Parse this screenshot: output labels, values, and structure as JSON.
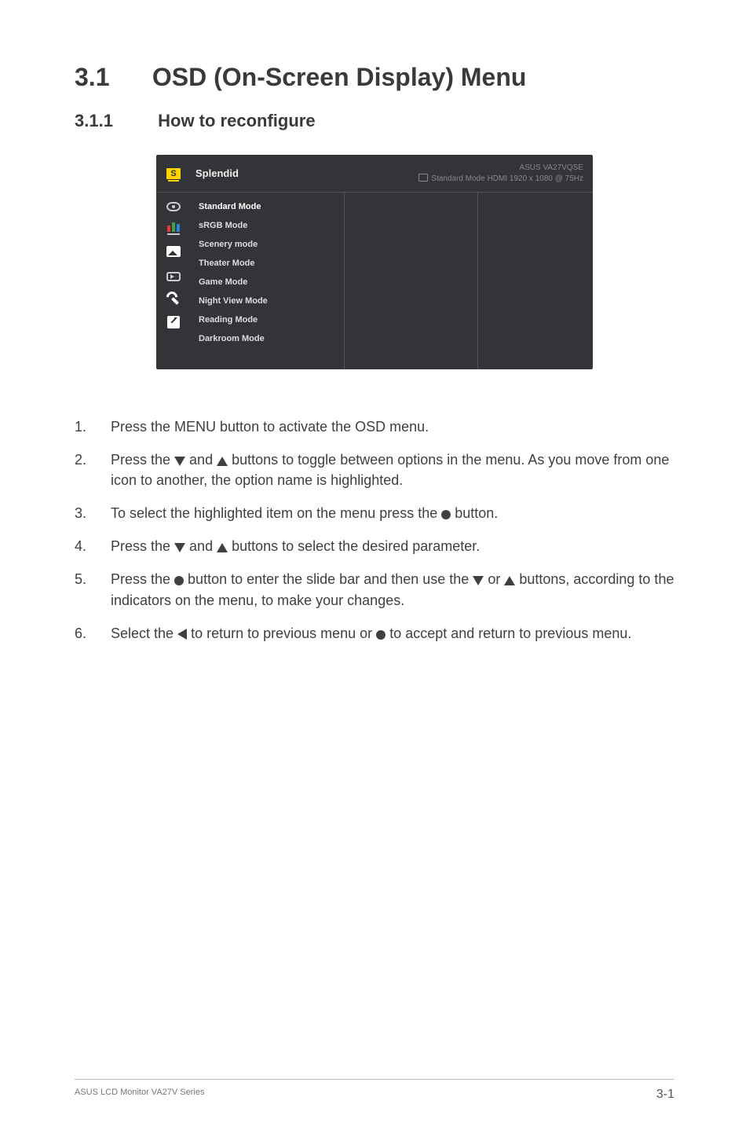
{
  "heading": {
    "number": "3.1",
    "title": "OSD (On-Screen Display) Menu"
  },
  "subheading": {
    "number": "3.1.1",
    "title": "How to reconfigure"
  },
  "osd": {
    "title": "Splendid",
    "model": "ASUS  VA27VQSE",
    "status": "Standard Mode HDMI 1920 x 1080 @ 75Hz",
    "items": [
      "Standard Mode",
      "sRGB Mode",
      "Scenery mode",
      "Theater Mode",
      "Game Mode",
      "Night View Mode",
      "Reading Mode",
      "Darkroom Mode"
    ],
    "sidebar": [
      "splendid-icon",
      "eye-icon",
      "color-icon",
      "image-icon",
      "input-icon",
      "settings-icon",
      "shortcut-icon"
    ]
  },
  "steps": {
    "s1": "Press the MENU button to activate the OSD menu.",
    "s2a": "Press the ",
    "s2b": " and ",
    "s2c": " buttons to toggle between options in the menu. As you move from one icon to another, the option name is highlighted.",
    "s3a": "To select the highlighted item on the menu press the ",
    "s3b": " button.",
    "s4a": "Press the ",
    "s4b": " and ",
    "s4c": " buttons to select the desired parameter.",
    "s5a": "Press the ",
    "s5b": " button to enter the slide bar and then use the ",
    "s5c": " or ",
    "s5d": " buttons, according to the indicators on the menu, to make your changes.",
    "s6a": "Select the ",
    "s6b": " to return to previous menu or ",
    "s6c": " to accept and return to previous menu."
  },
  "footer": {
    "left": "ASUS LCD Monitor VA27V Series",
    "page": "3-1"
  }
}
